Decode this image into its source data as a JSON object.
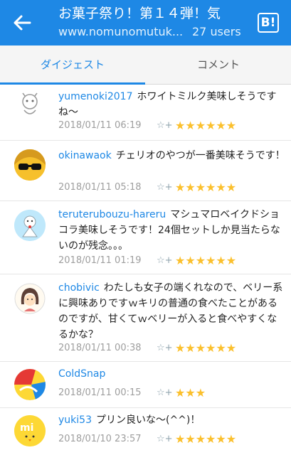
{
  "header": {
    "title": "お菓子祭り！第１４弾！気",
    "site": "www.nomunomutuk...",
    "users": "27 users",
    "b_label": "B!"
  },
  "tabs": {
    "digest": "ダイジェスト",
    "comments": "コメント"
  },
  "comments": [
    {
      "user": "yumenoki2017",
      "text": "ホワイトミルク美味しそうですね～",
      "date": "2018/01/11 06:19",
      "stars": "★★★★★★"
    },
    {
      "user": "okinawaok",
      "text": "チェリオのやつが一番美味そうです！",
      "date": "2018/01/11 05:18",
      "stars": "★★★★★★"
    },
    {
      "user": "teruterubouzu-hareru",
      "text": "マシュマロベイクドショコラ美味しそうです！24個セットしか見当たらないのが残念。。。",
      "date": "2018/01/11 01:19",
      "stars": "★★★★★★"
    },
    {
      "user": "chobivic",
      "text": "わたしも女子の端くれなので、ベリー系に興味ありですｗキリの普通の食べたことがあるのですが、甘くてｗベリーが入ると食べやすくなるかな？",
      "date": "2018/01/11 00:38",
      "stars": "★★★★★★"
    },
    {
      "user": "ColdSnap",
      "text": "",
      "date": "2018/01/11 00:15",
      "stars": "★★★"
    },
    {
      "user": "yuki53",
      "text": "プリン良いな～(^^)！",
      "date": "2018/01/10 23:57",
      "stars": "★★★★★★"
    }
  ],
  "star_add_icon": "☆+"
}
